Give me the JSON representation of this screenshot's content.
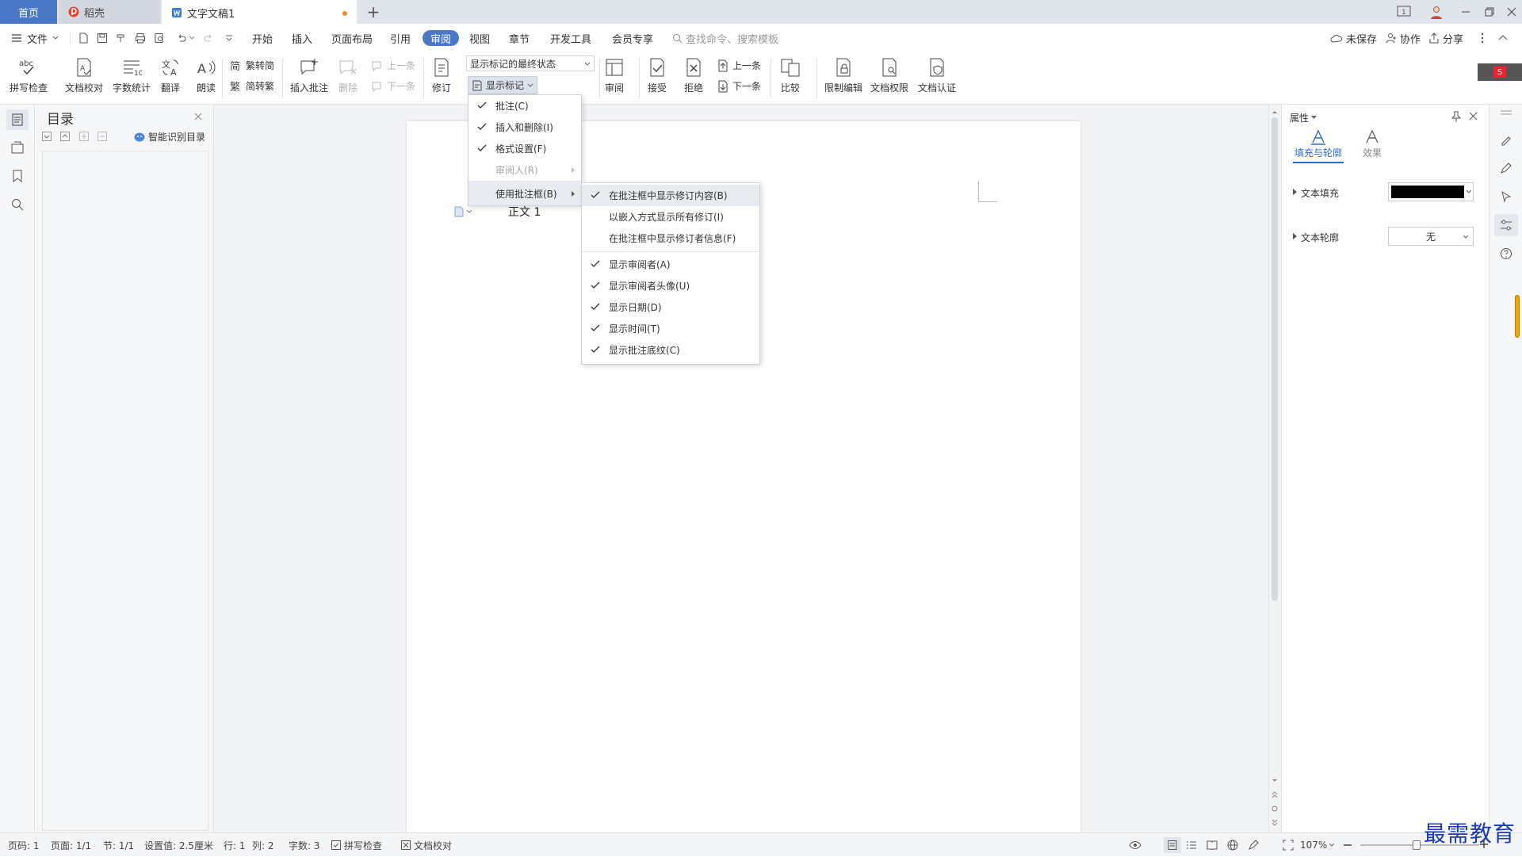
{
  "tabs": {
    "home": "首页",
    "daoke": "稻壳",
    "doc": "文字文稿1"
  },
  "menubar": {
    "file": "文件",
    "items": [
      "开始",
      "插入",
      "页面布局",
      "引用",
      "审阅",
      "视图",
      "章节",
      "开发工具",
      "会员专享"
    ],
    "active": "审阅",
    "search_placeholder": "查找命令、搜索模板",
    "unsaved": "未保存",
    "collab": "协作",
    "share": "分享"
  },
  "ribbon": {
    "spell": "拼写检查",
    "proof": "文档校对",
    "wordcount": "字数统计",
    "translate": "翻译",
    "read": "朗读",
    "trad2simp": "繁转简",
    "simp2trad": "简转繁",
    "insert_comment": "插入批注",
    "delete": "删除",
    "prev": "上一条",
    "next": "下一条",
    "revise": "修订",
    "markup_state": "显示标记的最终状态",
    "show_markup": "显示标记",
    "review": "审阅",
    "accept": "接受",
    "reject": "拒绝",
    "prev2": "上一条",
    "next2": "下一条",
    "compare": "比较",
    "restrict": "限制编辑",
    "perm": "文档权限",
    "cert": "文档认证"
  },
  "toc": {
    "title": "目录",
    "smart": "智能识别目录"
  },
  "document": {
    "heading": "正文 1"
  },
  "markup_menu": {
    "items": [
      {
        "label": "批注(C)",
        "checked": true
      },
      {
        "label": "插入和删除(I)",
        "checked": true
      },
      {
        "label": "格式设置(F)",
        "checked": true
      },
      {
        "label": "审阅人(R)",
        "checked": false,
        "disabled": true
      },
      {
        "label": "使用批注框(B)",
        "checked": false
      }
    ]
  },
  "balloon_menu": {
    "items": [
      {
        "label": "在批注框中显示修订内容(B)",
        "checked": true
      },
      {
        "label": "以嵌入方式显示所有修订(I)",
        "checked": false
      },
      {
        "label": "在批注框中显示修订者信息(F)",
        "checked": false
      },
      {
        "label": "显示审阅者(A)",
        "checked": true
      },
      {
        "label": "显示审阅者头像(U)",
        "checked": true
      },
      {
        "label": "显示日期(D)",
        "checked": true
      },
      {
        "label": "显示时间(T)",
        "checked": true
      },
      {
        "label": "显示批注底纹(C)",
        "checked": true
      }
    ]
  },
  "properties": {
    "title": "属性",
    "tab_fill": "填充与轮廓",
    "tab_effect": "效果",
    "text_fill": "文本填充",
    "text_outline": "文本轮廓",
    "outline_value": "无",
    "fill_color": "#000000"
  },
  "status": {
    "page_num": "页码: 1",
    "pages": "页面: 1/1",
    "section": "节: 1/1",
    "setting": "设置值: 2.5厘米",
    "row": "行: 1",
    "col": "列: 2",
    "chars": "字数: 3",
    "spell": "拼写检查",
    "proof": "文档校对",
    "zoom": "107%"
  },
  "watermark": "最需教育",
  "colors": {
    "accent": "#4a78c6"
  }
}
